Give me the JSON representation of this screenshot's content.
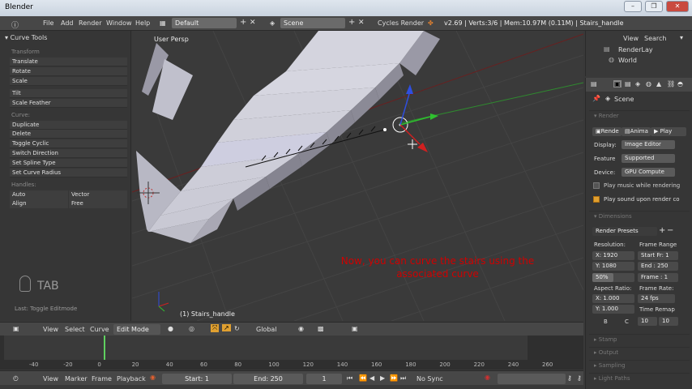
{
  "window": {
    "title": "Blender",
    "controls": [
      "–",
      "❐",
      "✕"
    ]
  },
  "topbar": {
    "menus": [
      "File",
      "Add",
      "Render",
      "Window",
      "Help"
    ],
    "screen_layout": "Default",
    "scene": "Scene",
    "engine": "Cycles Render",
    "stats": "v2.69 | Verts:3/6 | Mem:10.97M (0.11M) | Stairs_handle"
  },
  "toolshelf": {
    "title": "Curve Tools",
    "transform_label": "Transform",
    "transform": [
      "Translate",
      "Rotate",
      "Scale"
    ],
    "tools": [
      "Tilt",
      "Scale Feather"
    ],
    "curve_label": "Curve:",
    "curve": [
      "Duplicate",
      "Delete",
      "Toggle Cyclic",
      "Switch Direction",
      "Set Spline Type",
      "Set Curve Radius"
    ],
    "handles_label": "Handles:",
    "handles": [
      [
        "Auto",
        "Vector"
      ],
      [
        "Align",
        "Free"
      ]
    ],
    "tab_key": "TAB",
    "last_op": "Last: Toggle Editmode"
  },
  "viewport": {
    "view_name": "User Persp",
    "object_label": "(1) Stairs_handle",
    "overlay_line1": "Now, you can curve the stairs using the",
    "overlay_line2": "associated curve"
  },
  "viewport_header": {
    "menus": [
      "View",
      "Select",
      "Curve"
    ],
    "mode": "Edit Mode",
    "orientation": "Global"
  },
  "timeline": {
    "ticks": [
      "-40",
      "-20",
      "0",
      "20",
      "40",
      "60",
      "80",
      "100",
      "120",
      "140",
      "160",
      "180",
      "200",
      "220",
      "240",
      "260"
    ],
    "current_frame_value": 0,
    "menus": [
      "View",
      "Marker",
      "Frame",
      "Playback"
    ],
    "start": "Start: 1",
    "end": "End: 250",
    "current": "1",
    "sync": "No Sync"
  },
  "outliner": {
    "menus": [
      "View",
      "Search"
    ],
    "items": [
      "RenderLay",
      "World"
    ]
  },
  "properties": {
    "context": "Scene",
    "render_panel": "Render",
    "render_buttons": [
      "Rende",
      "Anima",
      "Play"
    ],
    "display_label": "Display:",
    "display_value": "Image Editor",
    "feature_label": "Feature",
    "feature_value": "Supported",
    "device_label": "Device:",
    "device_value": "GPU Compute",
    "play_music": "Play music while rendering",
    "play_music_checked": false,
    "play_sound": "Play sound upon render co",
    "play_sound_checked": true,
    "dimensions_panel": "Dimensions",
    "render_presets": "Render Presets",
    "resolution_label": "Resolution:",
    "res_x": "X: 1920",
    "res_y": "Y: 1080",
    "res_pct": "50%",
    "frame_range_label": "Frame Range",
    "start_frame": "Start Fr: 1",
    "end_frame": "End : 250",
    "frame_step": "Frame : 1",
    "aspect_label": "Aspect Ratio:",
    "aspect_x": "X: 1.000",
    "aspect_y": "Y: 1.000",
    "frame_rate_label": "Frame Rate:",
    "fps": "24 fps",
    "time_remap_label": "Time Remap",
    "remap_old": "10",
    "remap_new": "10",
    "b_label": "B",
    "c_label": "C",
    "panels": [
      "Stamp",
      "Output",
      "Sampling",
      "Light Paths"
    ]
  }
}
